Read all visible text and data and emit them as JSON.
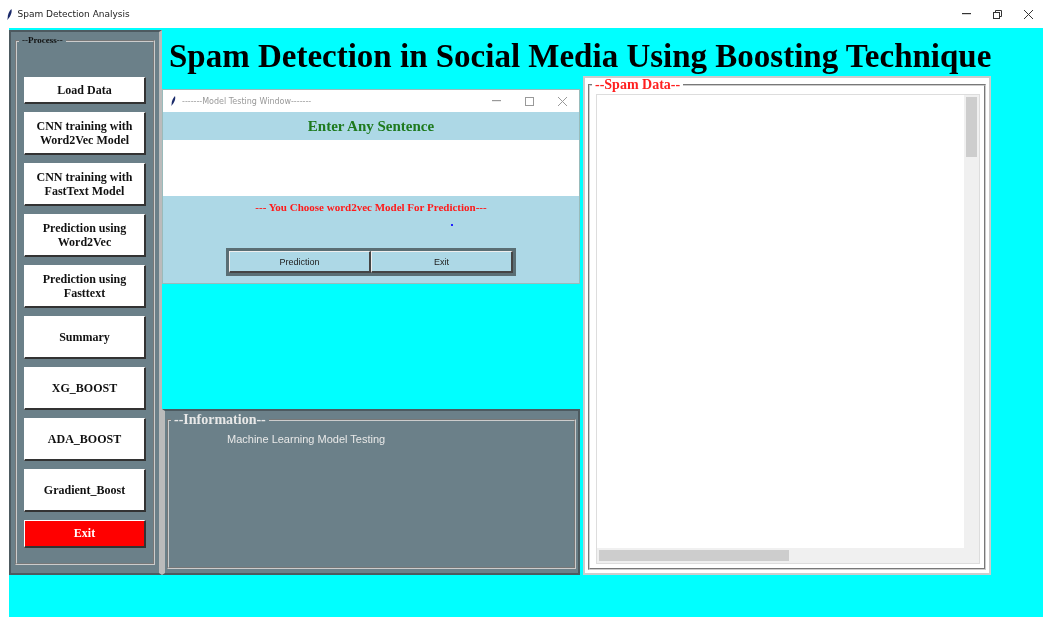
{
  "window": {
    "title": "Spam Detection Analysis"
  },
  "sidebar": {
    "legend": "--Process--",
    "buttons": [
      {
        "label": "Load Data",
        "kind": "normal"
      },
      {
        "label": "CNN training with Word2Vec Model",
        "kind": "normal"
      },
      {
        "label": "CNN training with FastText Model",
        "kind": "normal"
      },
      {
        "label": "Prediction using Word2Vec",
        "kind": "normal"
      },
      {
        "label": "Prediction using Fasttext",
        "kind": "normal"
      },
      {
        "label": "Summary",
        "kind": "normal"
      },
      {
        "label": "XG_BOOST",
        "kind": "normal"
      },
      {
        "label": "ADA_BOOST",
        "kind": "normal"
      },
      {
        "label": "Gradient_Boost",
        "kind": "normal"
      },
      {
        "label": "Exit",
        "kind": "danger"
      }
    ]
  },
  "heading": "Spam Detection in Social Media Using Boosting Technique",
  "model_window": {
    "title": "-------Model Testing Window-------",
    "prompt": "Enter Any Sentence",
    "message": "--- You Choose word2vec Model For Prediction---",
    "buttons": [
      "Prediction",
      "Exit"
    ]
  },
  "information": {
    "legend": "--Information--",
    "text": "Machine Learning Model Testing"
  },
  "spam_data": {
    "legend": "--Spam Data--"
  }
}
